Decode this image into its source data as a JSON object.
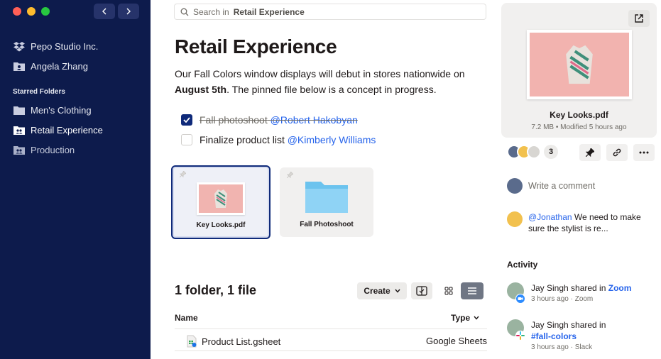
{
  "sidebar": {
    "org": "Pepo Studio Inc.",
    "user": "Angela Zhang",
    "starred_heading": "Starred Folders",
    "folders": [
      {
        "label": "Men's Clothing"
      },
      {
        "label": "Retail Experience"
      },
      {
        "label": "Production"
      }
    ]
  },
  "search": {
    "prefix": "Search in",
    "scope": "Retail Experience"
  },
  "page": {
    "title": "Retail Experience",
    "desc_part1": "Our Fall Colors window displays will debut in stores nationwide on ",
    "desc_bold": "August 5th",
    "desc_part2": ". The pinned file below is a concept in progress."
  },
  "todos": [
    {
      "text": "Fall photoshoot",
      "mention": "@Robert Hakobyan",
      "done": true
    },
    {
      "text": "Finalize product list",
      "mention": "@Kimberly Williams",
      "done": false
    }
  ],
  "pinned": [
    {
      "label": "Key Looks.pdf"
    },
    {
      "label": "Fall Photoshoot"
    }
  ],
  "listing": {
    "summary": "1 folder, 1 file",
    "create_label": "Create",
    "col_name": "Name",
    "col_type": "Type",
    "rows": [
      {
        "name": "Product List.gsheet",
        "type": "Google Sheets"
      }
    ]
  },
  "preview": {
    "file_name": "Key Looks.pdf",
    "meta": "7.2 MB • Modified 5 hours ago",
    "viewer_count": "3",
    "comment_placeholder": "Write a comment",
    "comment_mention": "@Jonathan",
    "comment_text": " We need to make sure the stylist is re..."
  },
  "activity": {
    "heading": "Activity",
    "items": [
      {
        "text": "Jay Singh shared in ",
        "target": "Zoom",
        "sub": "3 hours ago · Zoom"
      },
      {
        "text": "Jay Singh shared in",
        "target": "#fall-colors",
        "sub": "3 hours ago · Slack"
      }
    ]
  },
  "colors": {
    "sidebar_bg": "#0d1b4c",
    "accent": "#0f2a7a",
    "link": "#2563eb"
  }
}
